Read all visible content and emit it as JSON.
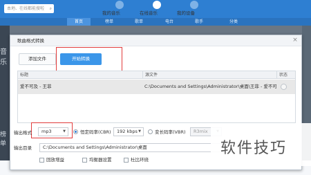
{
  "app": {
    "search_placeholder": "本地、在线都能搜啦",
    "top_nav": [
      {
        "label": "我的音乐",
        "active": false
      },
      {
        "label": "在线音乐",
        "active": true
      },
      {
        "label": "我的设备",
        "active": false
      }
    ],
    "tabs": [
      {
        "label": "首页",
        "active": true
      },
      {
        "label": "榜单",
        "active": false
      },
      {
        "label": "歌单",
        "active": false
      },
      {
        "label": "电台",
        "active": false
      },
      {
        "label": "歌手",
        "active": false
      },
      {
        "label": "分类",
        "active": false
      }
    ],
    "left_edge_1": "音乐",
    "left_edge_2": "榜单"
  },
  "dialog": {
    "title": "歌曲格式转换",
    "close": "×",
    "add_files_button": "添加文件",
    "start_button": "开始转换",
    "table": {
      "headers": [
        "标题",
        "源文件",
        "状态"
      ],
      "rows": [
        {
          "title": "爱不可及 - 王菲",
          "source": "C:\\Documents and Settings\\Administrator\\桌面\\王菲 - 爱不可及\\爱不可及 - 王菲"
        }
      ]
    },
    "output_format": {
      "label": "输出格式",
      "value": "mp3",
      "cbr_label": "恒定码率(CBR)",
      "cbr_value": "192 kbps",
      "vbr_label": "变长码率(VBR)",
      "vbr_value": "R3mix",
      "selected_mode": "CBR"
    },
    "output_dir": {
      "label": "输出目录",
      "value": "C:\\Documents and Settings\\Administrator\\桌面",
      "browse": "…"
    },
    "options": [
      {
        "label": "回放增益",
        "checked": false
      },
      {
        "label": "均衡器设置",
        "checked": false
      },
      {
        "label": "杜比环绕",
        "checked": false
      }
    ]
  },
  "watermark": "软件技巧",
  "colors": {
    "app_blue": "#2e7fd2",
    "primary_button": "#3b96e9",
    "highlight_box": "#e13b3b",
    "selected_row": "#e8e8e8"
  }
}
